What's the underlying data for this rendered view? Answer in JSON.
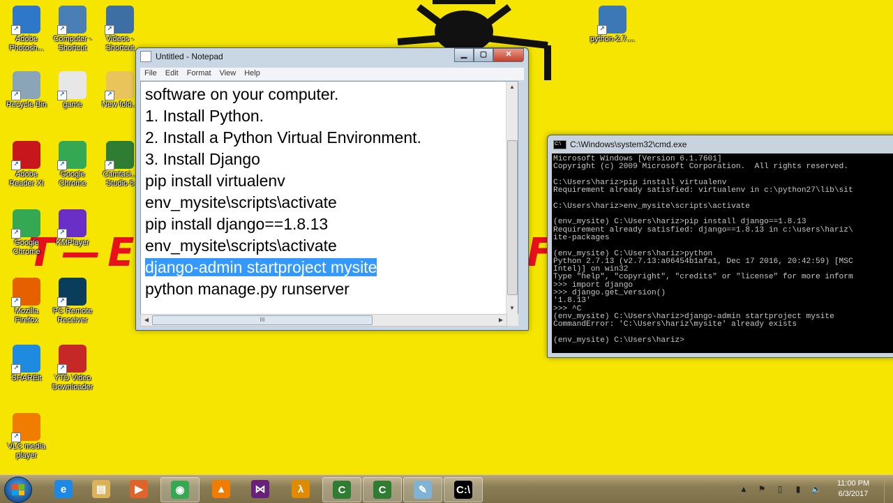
{
  "desktop": {
    "icons": [
      {
        "label": "Adobe\nPhotosh...",
        "icon": "photoshop-icon",
        "color": "#2f77c9"
      },
      {
        "label": "Computer -\nShortcut",
        "icon": "computer-icon",
        "color": "#4a7fb5"
      },
      {
        "label": "Videos -\nShortcut",
        "icon": "videos-folder-icon",
        "color": "#3d6fa5"
      },
      {
        "label": "Recycle Bin",
        "icon": "recycle-bin-icon",
        "color": "#8aa4b8"
      },
      {
        "label": "game",
        "icon": "python-file-icon",
        "color": "#e7e7e7"
      },
      {
        "label": "New fold...",
        "icon": "folder-icon",
        "color": "#e8c45a"
      },
      {
        "label": "Adobe\nReader XI",
        "icon": "adobe-reader-icon",
        "color": "#c8161d"
      },
      {
        "label": "Google\nChrome",
        "icon": "chrome-icon",
        "color": "#34a853"
      },
      {
        "label": "Camtasi...\nStudio 8",
        "icon": "camtasia-icon",
        "color": "#2e7d32"
      },
      {
        "label": "Google\nChrome",
        "icon": "chrome-icon",
        "color": "#34a853"
      },
      {
        "label": "KMPlayer",
        "icon": "kmplayer-icon",
        "color": "#6a2fc7"
      },
      {
        "label": "Mozilla\nFirefox",
        "icon": "firefox-icon",
        "color": "#e66000"
      },
      {
        "label": "PC Remote\nReceiver",
        "icon": "pc-remote-icon",
        "color": "#0a3d5c"
      },
      {
        "label": "SHAREit",
        "icon": "shareit-icon",
        "color": "#1e8be0"
      },
      {
        "label": "YTD Video\nDownloader",
        "icon": "ytd-downloader-icon",
        "color": "#c62828"
      },
      {
        "label": "VLC media\nplayer",
        "icon": "vlc-icon",
        "color": "#f07d00"
      },
      {
        "label": "python-2.7....",
        "icon": "python-installer-icon",
        "color": "#3c78b5"
      }
    ]
  },
  "notepad": {
    "title": "Untitled - Notepad",
    "menu": [
      "File",
      "Edit",
      "Format",
      "View",
      "Help"
    ],
    "lines": [
      "software on your computer.",
      "1. Install Python.",
      "2. Install a Python Virtual Environment.",
      "3. Install Django",
      "pip install virtualenv",
      "env_mysite\\scripts\\activate",
      "pip install django==1.8.13",
      "env_mysite\\scripts\\activate",
      "django-admin startproject mysite",
      "python manage.py runserver"
    ],
    "selected_line_index": 8,
    "hscroll_grip": "III"
  },
  "cmd": {
    "title": "C:\\Windows\\system32\\cmd.exe",
    "lines": [
      "Microsoft Windows [Version 6.1.7601]",
      "Copyright (c) 2009 Microsoft Corporation.  All rights reserved.",
      "",
      "C:\\Users\\hariz>pip install virtualenv",
      "Requirement already satisfied: virtualenv in c:\\python27\\lib\\sit",
      "",
      "C:\\Users\\hariz>env_mysite\\scripts\\activate",
      "",
      "(env_mysite) C:\\Users\\hariz>pip install django==1.8.13",
      "Requirement already satisfied: django==1.8.13 in c:\\users\\hariz\\",
      "ite-packages",
      "",
      "(env_mysite) C:\\Users\\hariz>python",
      "Python 2.7.13 (v2.7.13:a06454b1afa1, Dec 17 2016, 20:42:59) [MSC",
      "Intel)] on win32",
      "Type \"help\", \"copyright\", \"credits\" or \"license\" for more inform",
      ">>> import django",
      ">>> django.get_version()",
      "'1.8.13'",
      ">>> ^C",
      "(env_mysite) C:\\Users\\hariz>django-admin startproject mysite",
      "CommandError: 'C:\\Users\\hariz\\mysite' already exists",
      "",
      "(env_mysite) C:\\Users\\hariz>"
    ]
  },
  "taskbar": {
    "items": [
      {
        "name": "internet-explorer-icon",
        "glyph": "e",
        "color": "#1e88e5",
        "active": false
      },
      {
        "name": "explorer-folder-icon",
        "glyph": "▤",
        "color": "#d9b25a",
        "active": false
      },
      {
        "name": "media-player-icon",
        "glyph": "▶",
        "color": "#e0642a",
        "active": false
      },
      {
        "name": "chrome-icon",
        "glyph": "◉",
        "color": "#34a853",
        "active": true
      },
      {
        "name": "vlc-icon",
        "glyph": "▲",
        "color": "#f07d00",
        "active": false
      },
      {
        "name": "visual-studio-icon",
        "glyph": "⋈",
        "color": "#68217a",
        "active": false
      },
      {
        "name": "half-life-icon",
        "glyph": "λ",
        "color": "#e08a00",
        "active": false
      },
      {
        "name": "camtasia-recorder-icon",
        "glyph": "C",
        "color": "#2e7d32",
        "active": true
      },
      {
        "name": "camtasia-studio-icon",
        "glyph": "C",
        "color": "#2e7d32",
        "active": true
      },
      {
        "name": "notepad-icon",
        "glyph": "✎",
        "color": "#7fb3d5",
        "active": true
      },
      {
        "name": "cmd-icon",
        "glyph": "C:\\",
        "color": "#000000",
        "active": true
      }
    ],
    "clock_time": "11:00 PM",
    "clock_date": "6/3/2017"
  }
}
